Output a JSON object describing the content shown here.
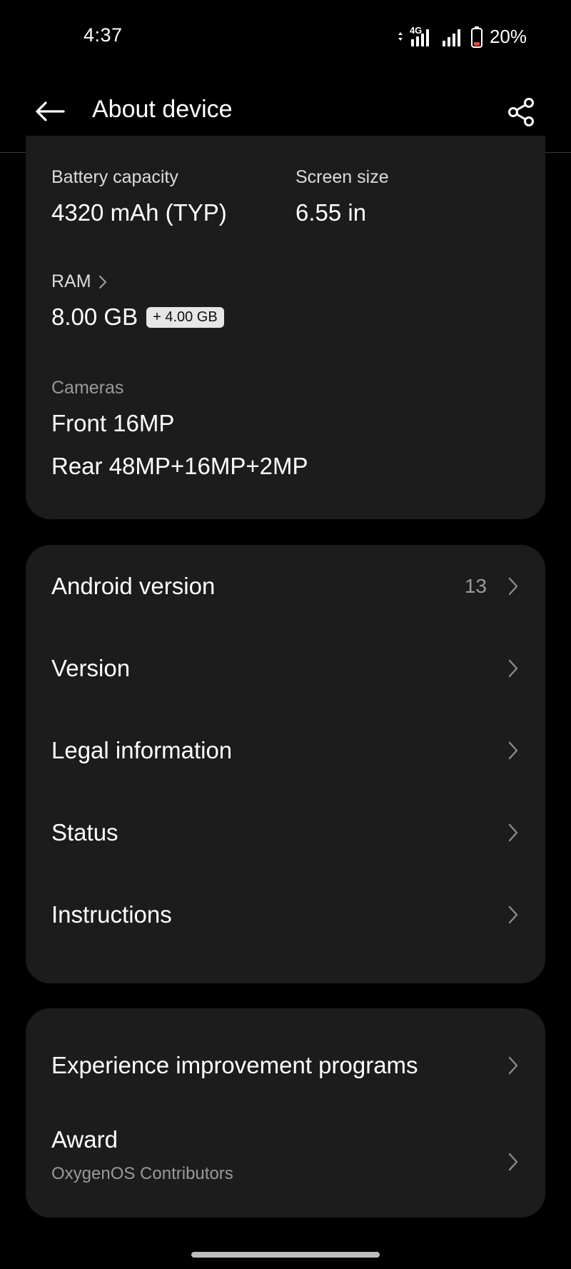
{
  "status_bar": {
    "time": "4:37",
    "network_label": "4G",
    "battery": "20%"
  },
  "app_bar": {
    "title": "About device",
    "back_icon": "arrow-left-icon",
    "share_icon": "share-icon"
  },
  "specs": {
    "battery": {
      "label": "Battery capacity",
      "value": "4320 mAh (TYP)"
    },
    "screen": {
      "label": "Screen size",
      "value": "6.55 in"
    },
    "ram": {
      "label": "RAM",
      "value": "8.00 GB",
      "badge": "+ 4.00 GB"
    },
    "cameras": {
      "label": "Cameras",
      "front": "Front 16MP",
      "rear": "Rear 48MP+16MP+2MP"
    }
  },
  "system_items": [
    {
      "label": "Android version",
      "value": "13"
    },
    {
      "label": "Version",
      "value": ""
    },
    {
      "label": "Legal information",
      "value": ""
    },
    {
      "label": "Status",
      "value": ""
    },
    {
      "label": "Instructions",
      "value": ""
    }
  ],
  "extra_items": {
    "experience": {
      "label": "Experience improvement programs"
    },
    "award": {
      "label": "Award",
      "subtitle": "OxygenOS Contributors"
    }
  },
  "colors": {
    "background": "#000000",
    "card": "#1c1c1c",
    "text_primary": "#ffffff",
    "text_secondary": "#9a9a9a",
    "battery_low": "#e5483b"
  }
}
